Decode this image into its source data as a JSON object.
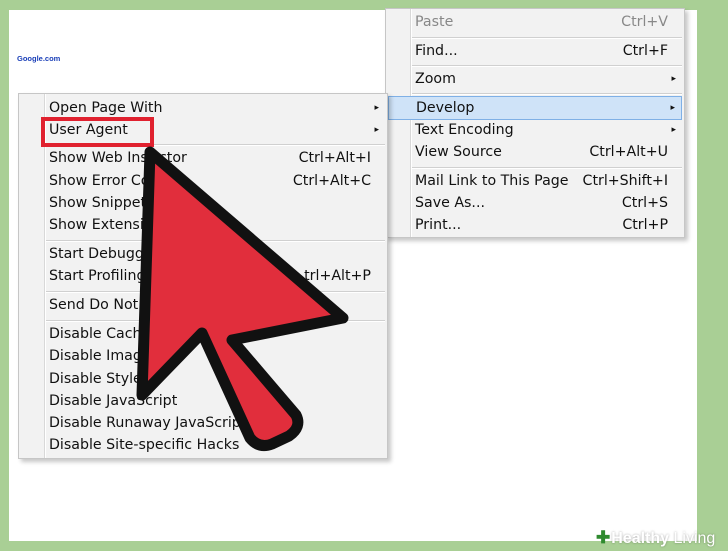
{
  "page": {
    "link_text": "Google.com"
  },
  "main_menu": {
    "items": [
      {
        "label": "Paste",
        "shortcut": "Ctrl+V",
        "disabled": true
      },
      {
        "label": "Find...",
        "shortcut": "Ctrl+F"
      },
      {
        "label": "Zoom",
        "submenu": true
      },
      {
        "label": "Develop",
        "submenu": true,
        "highlighted": true
      },
      {
        "label": "Text Encoding",
        "submenu": true
      },
      {
        "label": "View Source",
        "shortcut": "Ctrl+Alt+U"
      },
      {
        "label": "Mail Link to This Page",
        "shortcut": "Ctrl+Shift+I"
      },
      {
        "label": "Save As...",
        "shortcut": "Ctrl+S"
      },
      {
        "label": "Print...",
        "shortcut": "Ctrl+P"
      }
    ]
  },
  "develop_menu": {
    "items": [
      {
        "label": "Open Page With",
        "submenu": true
      },
      {
        "label": "User Agent",
        "submenu": true
      },
      {
        "label": "Show Web Inspector",
        "visible_label": "Show Web Ins",
        "visible_tail": "ctor",
        "shortcut": "Ctrl+Alt+I"
      },
      {
        "label": "Show Error Co",
        "shortcut": "Ctrl+Alt+C"
      },
      {
        "label": "Show Snippet"
      },
      {
        "label": "Show Extensio"
      },
      {
        "label": "Start Debuggi"
      },
      {
        "label": "Start Profiling",
        "shortcut": "trl+Alt+P"
      },
      {
        "label": "Send Do Not"
      },
      {
        "label": "Disable Cache"
      },
      {
        "label": "Disable Image"
      },
      {
        "label": "Disable Styles"
      },
      {
        "label": "Disable JavaScript"
      },
      {
        "label": "Disable Runaway JavaScript Ti"
      },
      {
        "label": "Disable Site-specific Hacks"
      }
    ]
  },
  "arrow_indicator": {
    "color": "#e12e3c",
    "outline": "#111111"
  },
  "watermark": {
    "brand_word": "Healthy",
    "brand_word2": "Living",
    "icon": "plus-leaf-icon"
  }
}
